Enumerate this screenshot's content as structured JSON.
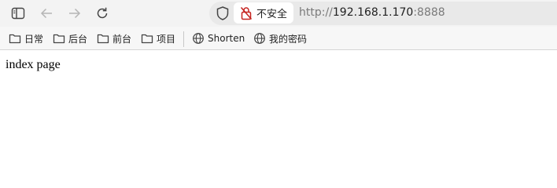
{
  "toolbar": {
    "sidebar_icon": "sidebar-toggle-icon",
    "back_icon": "arrow-left-icon",
    "forward_icon": "arrow-right-icon",
    "refresh_icon": "refresh-icon",
    "tracking_icon": "shield-icon"
  },
  "addressbar": {
    "security_label": "不安全",
    "security_icon": "not-secure-lock-icon",
    "url_scheme": "http://",
    "url_host": "192.168.1.170",
    "url_port": ":8888"
  },
  "bookmarks": {
    "items": [
      {
        "label": "日常",
        "icon": "folder-icon"
      },
      {
        "label": "后台",
        "icon": "folder-icon"
      },
      {
        "label": "前台",
        "icon": "folder-icon"
      },
      {
        "label": "项目",
        "icon": "folder-icon"
      },
      {
        "label": "Shorten",
        "icon": "globe-icon"
      },
      {
        "label": "我的密码",
        "icon": "globe-icon"
      }
    ]
  },
  "page": {
    "text": "index page"
  },
  "colors": {
    "toolbar_bg": "#f3f3f3",
    "addressbar_bg": "#e9e9e9",
    "not_secure_red": "#c5221f",
    "text": "#1f1f1f",
    "url_dim": "#7a7a7a"
  }
}
